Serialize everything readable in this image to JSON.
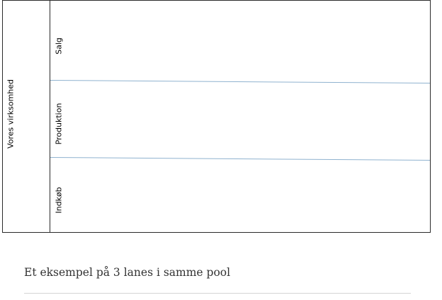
{
  "diagram": {
    "pool_label": "Vores virksomhed",
    "lanes": [
      {
        "label": "Salg"
      },
      {
        "label": "Produktion"
      },
      {
        "label": "Indkøb"
      }
    ]
  },
  "caption": {
    "text": "Et eksempel på 3 lanes i samme pool"
  }
}
